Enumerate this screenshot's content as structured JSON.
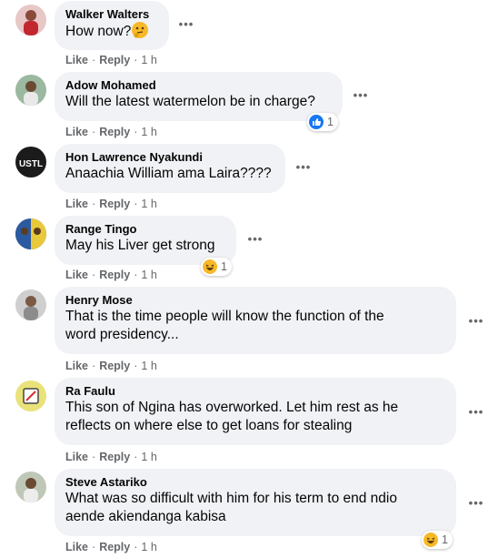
{
  "comments": [
    {
      "author": "Walker Walters",
      "text_lines": [
        "How now?"
      ],
      "inline_emoji": "thinking-face",
      "actions": {
        "like": "Like",
        "reply": "Reply",
        "time": "1 h"
      }
    },
    {
      "author": "Adow Mohamed",
      "text_lines": [
        "Will the latest watermelon be in charge?"
      ],
      "actions": {
        "like": "Like",
        "reply": "Reply",
        "time": "1 h"
      },
      "reaction": {
        "icon": "like-icon",
        "count": "1"
      }
    },
    {
      "author": "Hon Lawrence Nyakundi",
      "avatar_text": "USTL",
      "text_lines": [
        "Anaachia William ama Laira????"
      ],
      "actions": {
        "like": "Like",
        "reply": "Reply",
        "time": "1 h"
      }
    },
    {
      "author": "Range Tingo",
      "text_lines": [
        "May his Liver get strong"
      ],
      "actions": {
        "like": "Like",
        "reply": "Reply",
        "time": "1 h"
      },
      "reaction": {
        "icon": "haha-icon",
        "count": "1"
      }
    },
    {
      "author": "Henry Mose",
      "text_lines": [
        "That is the time people will know the function of the",
        "word presidency..."
      ],
      "actions": {
        "like": "Like",
        "reply": "Reply",
        "time": "1 h"
      }
    },
    {
      "author": "Ra Faulu",
      "text_lines": [
        "This son of Ngina has overworked. Let him rest as he",
        "reflects on where else to get loans for stealing"
      ],
      "actions": {
        "like": "Like",
        "reply": "Reply",
        "time": "1 h"
      }
    },
    {
      "author": "Steve Astariko",
      "text_lines": [
        "What was so difficult with him for his term to end ndio",
        "aende akiendanga kabisa"
      ],
      "actions": {
        "like": "Like",
        "reply": "Reply",
        "time": "1 h"
      },
      "reaction": {
        "icon": "haha-icon",
        "count": "1"
      }
    }
  ],
  "more_icon": "more-horizontal-icon",
  "colors": {
    "bubble": "#f0f2f5",
    "secondary_text": "#65676b",
    "like_blue": "#1877f2",
    "haha_yellow": "#f7b928"
  }
}
